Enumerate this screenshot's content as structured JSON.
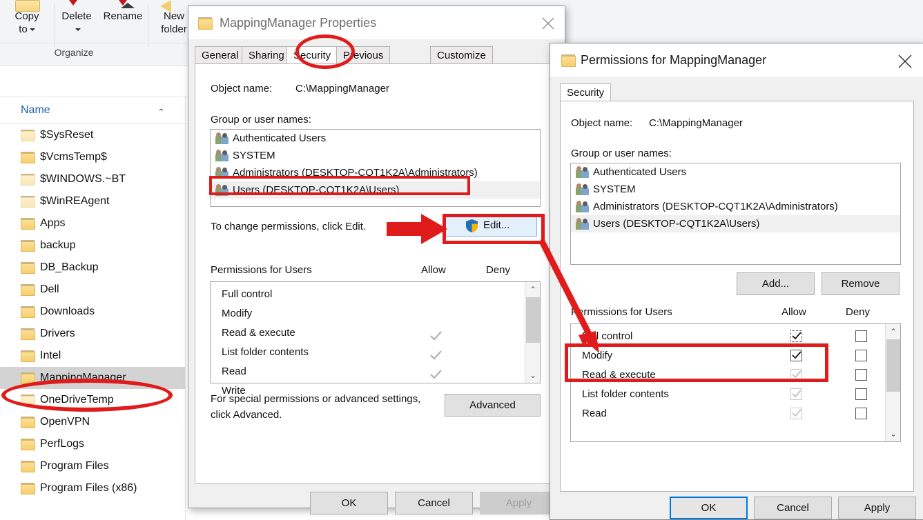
{
  "explorer": {
    "ribbon": {
      "buttons": [
        {
          "label_line1": "Copy",
          "label_line2": "to",
          "icon": "copy-to-icon",
          "has_caret": true
        },
        {
          "label_line1": "Delete",
          "label_line2": "",
          "icon": "delete-icon",
          "has_caret": true
        },
        {
          "label_line1": "Rename",
          "label_line2": "",
          "icon": "rename-icon",
          "has_caret": false
        },
        {
          "label_line1": "New",
          "label_line2": "folder",
          "icon": "new-folder-icon",
          "has_caret": false
        }
      ],
      "group_label": "Organize"
    },
    "column_header": {
      "name": "Name",
      "sort_glyph": "⌃"
    },
    "files": [
      {
        "name": "$SysReset",
        "dim": true,
        "selected": false
      },
      {
        "name": "$VcmsTemp$",
        "dim": false,
        "selected": false
      },
      {
        "name": "$WINDOWS.~BT",
        "dim": true,
        "selected": false
      },
      {
        "name": "$WinREAgent",
        "dim": true,
        "selected": false
      },
      {
        "name": "Apps",
        "dim": false,
        "selected": false
      },
      {
        "name": "backup",
        "dim": false,
        "selected": false
      },
      {
        "name": "DB_Backup",
        "dim": false,
        "selected": false
      },
      {
        "name": "Dell",
        "dim": false,
        "selected": false
      },
      {
        "name": "Downloads",
        "dim": false,
        "selected": false
      },
      {
        "name": "Drivers",
        "dim": false,
        "selected": false
      },
      {
        "name": "Intel",
        "dim": false,
        "selected": false
      },
      {
        "name": "MappingManager",
        "dim": false,
        "selected": true
      },
      {
        "name": "OneDriveTemp",
        "dim": true,
        "selected": false
      },
      {
        "name": "OpenVPN",
        "dim": false,
        "selected": false
      },
      {
        "name": "PerfLogs",
        "dim": false,
        "selected": false
      },
      {
        "name": "Program Files",
        "dim": false,
        "selected": false
      },
      {
        "name": "Program Files (x86)",
        "dim": false,
        "selected": false
      }
    ]
  },
  "properties_dialog": {
    "title": "MappingManager Properties",
    "close_icon": "close-icon",
    "folder_icon": "folder-icon",
    "tabs": [
      {
        "label": "General",
        "active": false
      },
      {
        "label": "Sharing",
        "active": false
      },
      {
        "label": "Security",
        "active": true
      },
      {
        "label": "Previous Versions",
        "active": false
      },
      {
        "label": "Customize",
        "active": false
      }
    ],
    "object_name_label": "Object name:",
    "object_name_value": "C:\\MappingManager",
    "group_list_label": "Group or user names:",
    "groups": [
      {
        "name": "Authenticated Users",
        "selected": false
      },
      {
        "name": "SYSTEM",
        "selected": false
      },
      {
        "name": "Administrators (DESKTOP-CQT1K2A\\Administrators)",
        "selected": false
      },
      {
        "name": "Users (DESKTOP-CQT1K2A\\Users)",
        "selected": true
      }
    ],
    "edit_hint": "To change permissions, click Edit.",
    "edit_button": "Edit...",
    "edit_button_icon": "uac-shield-icon",
    "permissions_header": "Permissions for Users",
    "allow_header": "Allow",
    "deny_header": "Deny",
    "permissions": [
      {
        "name": "Full control",
        "allow": false,
        "deny": false
      },
      {
        "name": "Modify",
        "allow": false,
        "deny": false
      },
      {
        "name": "Read & execute",
        "allow": true,
        "deny": false
      },
      {
        "name": "List folder contents",
        "allow": true,
        "deny": false
      },
      {
        "name": "Read",
        "allow": true,
        "deny": false
      },
      {
        "name": "Write",
        "allow": false,
        "deny": false
      }
    ],
    "advanced_hint_line1": "For special permissions or advanced settings,",
    "advanced_hint_line2": "click Advanced.",
    "advanced_button": "Advanced",
    "ok_button": "OK",
    "cancel_button": "Cancel",
    "apply_button": "Apply",
    "apply_disabled": true,
    "scroll_up_glyph": "⌃",
    "scroll_down_glyph": "⌄"
  },
  "permissions_dialog": {
    "title": "Permissions for MappingManager",
    "close_icon": "close-icon",
    "folder_icon": "folder-icon",
    "tabs": [
      {
        "label": "Security",
        "active": true
      }
    ],
    "object_name_label": "Object name:",
    "object_name_value": "C:\\MappingManager",
    "group_list_label": "Group or user names:",
    "groups": [
      {
        "name": "Authenticated Users",
        "selected": false
      },
      {
        "name": "SYSTEM",
        "selected": false
      },
      {
        "name": "Administrators (DESKTOP-CQT1K2A\\Administrators)",
        "selected": false
      },
      {
        "name": "Users (DESKTOP-CQT1K2A\\Users)",
        "selected": true
      }
    ],
    "add_button": "Add...",
    "remove_button": "Remove",
    "permissions_header": "Permissions for Users",
    "allow_header": "Allow",
    "deny_header": "Deny",
    "permissions": [
      {
        "name": "Full control",
        "allow_checked": true,
        "allow_enabled": true,
        "allow_focused": true,
        "deny_checked": false
      },
      {
        "name": "Modify",
        "allow_checked": true,
        "allow_enabled": true,
        "allow_focused": false,
        "deny_checked": false
      },
      {
        "name": "Read & execute",
        "allow_checked": true,
        "allow_enabled": false,
        "allow_focused": false,
        "deny_checked": false
      },
      {
        "name": "List folder contents",
        "allow_checked": true,
        "allow_enabled": false,
        "allow_focused": false,
        "deny_checked": false
      },
      {
        "name": "Read",
        "allow_checked": true,
        "allow_enabled": false,
        "allow_focused": false,
        "deny_checked": false
      }
    ],
    "ok_button": "OK",
    "cancel_button": "Cancel",
    "apply_button": "Apply",
    "scroll_up_glyph": "⌃",
    "scroll_down_glyph": "⌄"
  },
  "annotations": {
    "accent_color": "#e01b1b",
    "marks": [
      {
        "name": "ellipse-mappingmanager-folder",
        "shape": "ellipse"
      },
      {
        "name": "ellipse-security-tab",
        "shape": "ellipse"
      },
      {
        "name": "box-users-group-row",
        "shape": "rectangle"
      },
      {
        "name": "arrow-to-edit-button",
        "shape": "arrow"
      },
      {
        "name": "box-edit-button",
        "shape": "rectangle"
      },
      {
        "name": "connector-edit-to-permissions",
        "shape": "arrow-line"
      },
      {
        "name": "box-full-control-modify",
        "shape": "rectangle"
      }
    ]
  }
}
